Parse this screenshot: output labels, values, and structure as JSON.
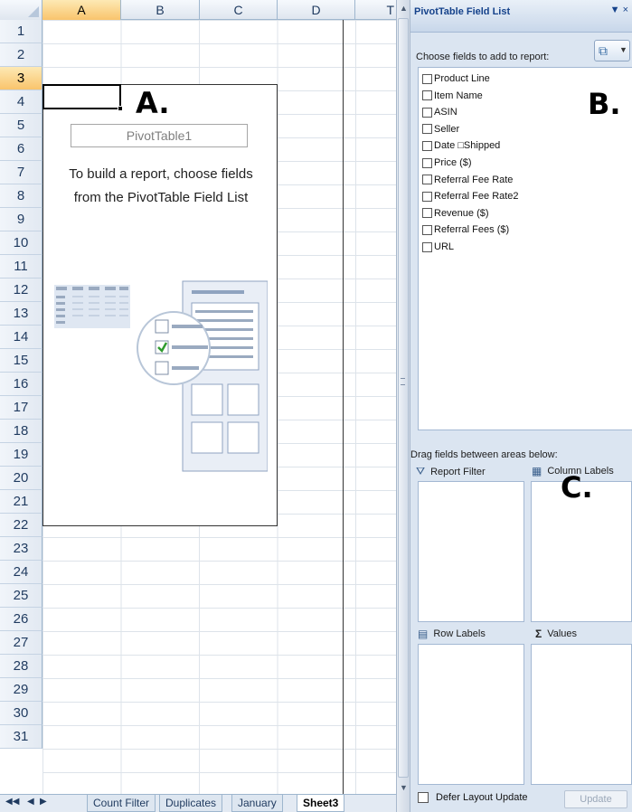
{
  "sheet": {
    "columns": [
      "A",
      "B",
      "C",
      "D",
      "T"
    ],
    "rows": [
      "1",
      "2",
      "3",
      "4",
      "5",
      "6",
      "7",
      "8",
      "9",
      "10",
      "11",
      "12",
      "13",
      "14",
      "15",
      "16",
      "17",
      "18",
      "19",
      "20",
      "21",
      "22",
      "23",
      "24",
      "25",
      "26",
      "27",
      "28",
      "29",
      "30",
      "31"
    ],
    "selected_cell": "A3"
  },
  "pivot": {
    "name": "PivotTable1",
    "instruction_line1": "To build a report, choose fields",
    "instruction_line2": "from the PivotTable Field List"
  },
  "callouts": {
    "a": "A.",
    "b": "B.",
    "c": "C."
  },
  "tabs": {
    "nav": [
      "◀◀",
      "◀",
      "▶"
    ],
    "sheets": [
      "Count Filter",
      "Duplicates",
      "January",
      "Sheet3"
    ],
    "active": "Sheet3"
  },
  "field_list": {
    "title": "PivotTable Field List",
    "title_controls": "▼ ×",
    "choose_label": "Choose fields to add to report:",
    "fields": [
      {
        "label": "Product Line",
        "checked": false
      },
      {
        "label": "Item Name",
        "checked": false
      },
      {
        "label": "ASIN",
        "checked": false
      },
      {
        "label": "Seller",
        "checked": false
      },
      {
        "label": "Date □Shipped",
        "checked": false
      },
      {
        "label": "Price ($)",
        "checked": false
      },
      {
        "label": "Referral Fee Rate",
        "checked": false
      },
      {
        "label": "Referral Fee Rate2",
        "checked": false
      },
      {
        "label": "Revenue ($)",
        "checked": false
      },
      {
        "label": "Referral Fees ($)",
        "checked": false
      },
      {
        "label": "URL",
        "checked": false
      }
    ],
    "drag_label": "Drag fields between areas below:",
    "areas": {
      "report_filter": "Report Filter",
      "column_labels": "Column Labels",
      "row_labels": "Row Labels",
      "values": "Values"
    },
    "defer_label": "Defer Layout Update",
    "update_label": "Update"
  }
}
